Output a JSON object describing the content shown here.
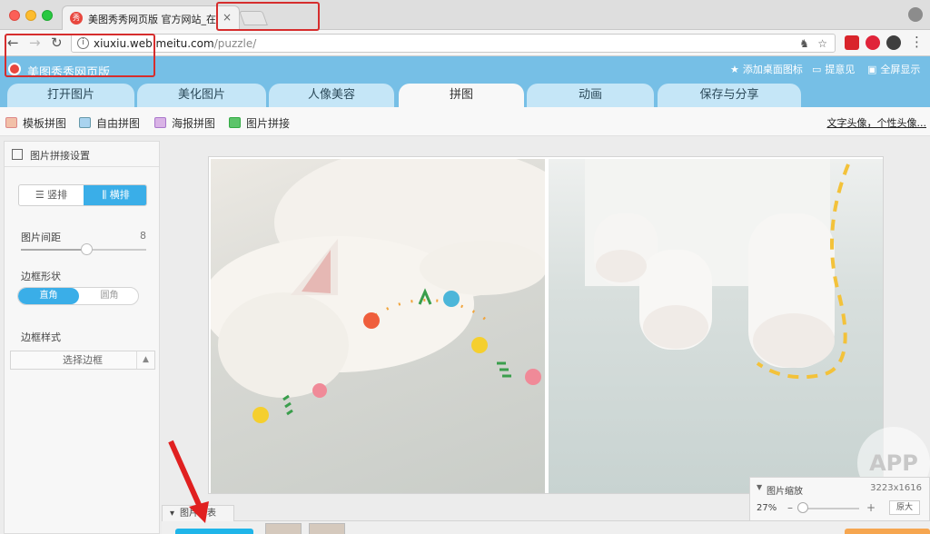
{
  "browser": {
    "tab_title": "美图秀秀网页版 官方网站_在线",
    "tab_favicon": "秀",
    "url_host": "xiuxiu.web.meitu.com",
    "url_path": "/puzzle/"
  },
  "site": {
    "title": "美图秀秀网页版",
    "header_links": [
      {
        "icon": "star-icon",
        "label": "添加桌面图标"
      },
      {
        "icon": "feedback-icon",
        "label": "提意见"
      },
      {
        "icon": "fullscreen-icon",
        "label": "全屏显示"
      }
    ],
    "main_tabs": [
      {
        "label": "打开图片"
      },
      {
        "label": "美化图片"
      },
      {
        "label": "人像美容"
      },
      {
        "label": "拼图",
        "active": true
      },
      {
        "label": "动画"
      },
      {
        "label": "保存与分享"
      }
    ]
  },
  "subtabs": {
    "items": [
      {
        "label": "模板拼图"
      },
      {
        "label": "自由拼图"
      },
      {
        "label": "海报拼图"
      },
      {
        "label": "图片拼接",
        "active": true
      }
    ],
    "right_link": "文字头像，个性头像..."
  },
  "panel": {
    "title": "图片拼接设置",
    "orientation": {
      "vertical": "竖排",
      "horizontal": "横排",
      "selected": "横排"
    },
    "spacing": {
      "label": "图片间距",
      "value": "8"
    },
    "border_shape": {
      "label": "边框形状",
      "options": [
        "直角",
        "圆角"
      ],
      "selected": "直角"
    },
    "border_style": {
      "label": "边框样式",
      "select": "选择边框"
    }
  },
  "bottom": {
    "strip_tab": "图片列表"
  },
  "zoom": {
    "title": "图片缩放",
    "dimensions": "3223x1616",
    "percent": "27%",
    "minus": "–",
    "plus": "+",
    "fit": "原大"
  },
  "watermark": "APP",
  "colors": {
    "header": "#76bfe6",
    "accent": "#3aaee8",
    "highlight": "#d62d2d"
  }
}
